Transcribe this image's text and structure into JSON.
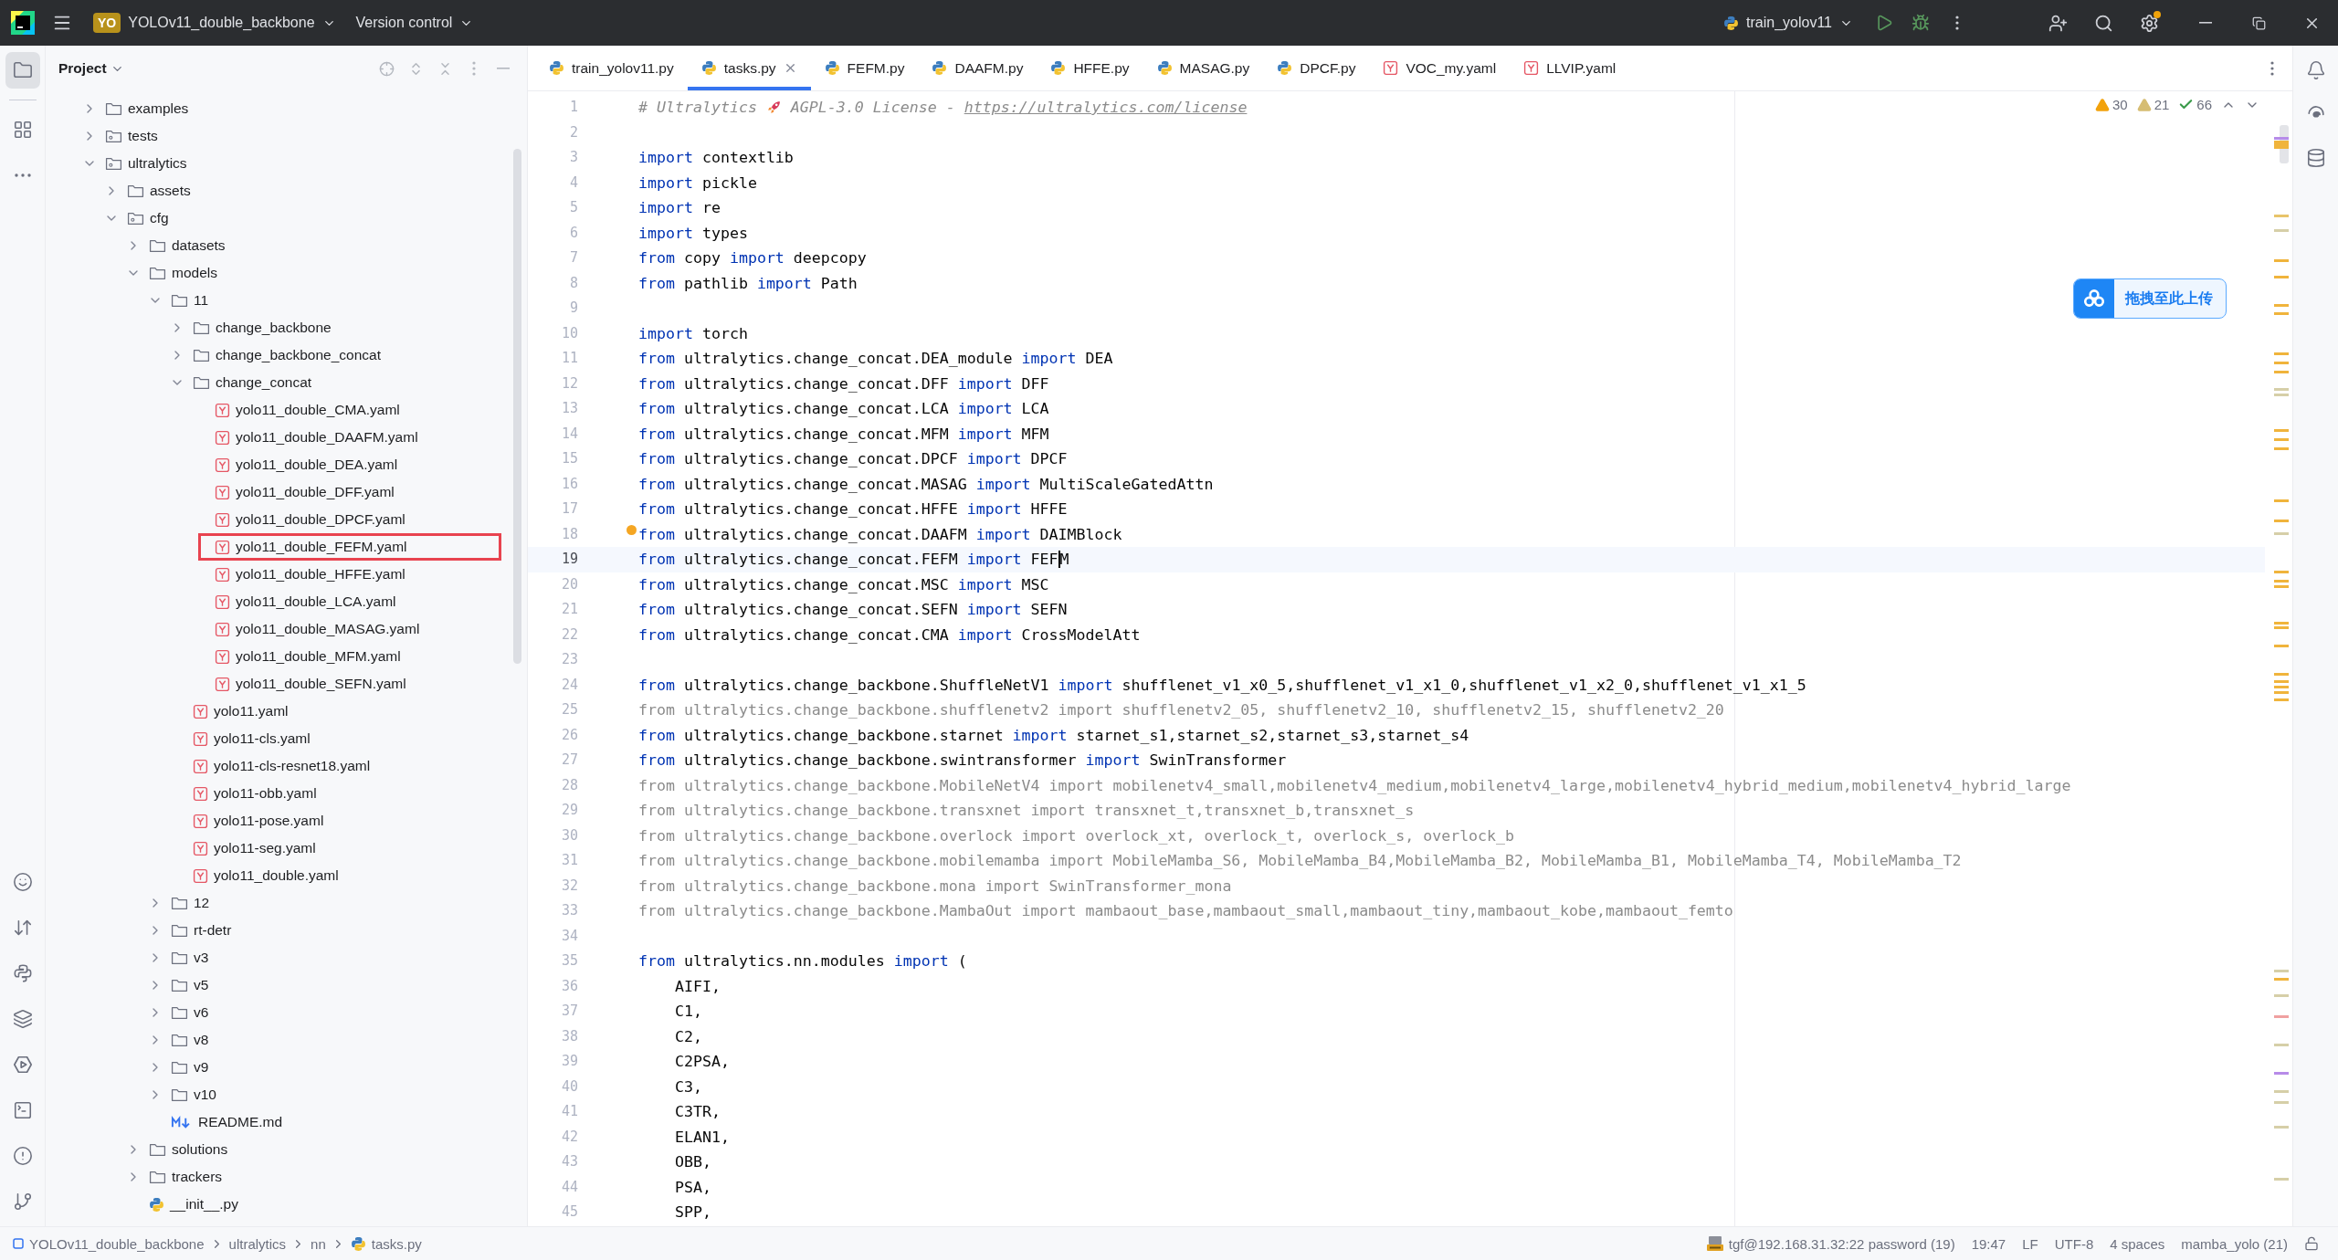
{
  "title_bar": {
    "project_badge": "YO",
    "project_name": "YOLOv11_double_backbone",
    "vcs_menu": "Version control",
    "run_config": "train_yolov11",
    "settings_update": true
  },
  "tool_strip": {
    "top": [
      {
        "kind": "project",
        "selected": true
      },
      {
        "kind": "structure",
        "selected": false
      },
      {
        "kind": "more",
        "selected": false
      }
    ],
    "bottom": [
      {
        "kind": "face",
        "selected": false
      },
      {
        "kind": "transfer",
        "selected": false
      },
      {
        "kind": "python",
        "selected": false
      },
      {
        "kind": "layers",
        "selected": false
      },
      {
        "kind": "services",
        "selected": false
      },
      {
        "kind": "terminal",
        "selected": false
      },
      {
        "kind": "problems",
        "selected": false
      },
      {
        "kind": "git",
        "selected": false
      }
    ]
  },
  "project": {
    "title": "Project",
    "tree": [
      {
        "label": "examples",
        "kind": "folder",
        "expanded": false
      },
      {
        "label": "tests",
        "kind": "package",
        "expanded": false
      },
      {
        "label": "ultralytics",
        "kind": "package",
        "expanded": true,
        "children": [
          {
            "label": "assets",
            "kind": "folder",
            "expanded": false
          },
          {
            "label": "cfg",
            "kind": "package",
            "expanded": true,
            "children": [
              {
                "label": "datasets",
                "kind": "folder",
                "expanded": false
              },
              {
                "label": "models",
                "kind": "folder",
                "expanded": true,
                "children": [
                  {
                    "label": "11",
                    "kind": "folder",
                    "expanded": true,
                    "children": [
                      {
                        "label": "change_backbone",
                        "kind": "folder",
                        "expanded": false
                      },
                      {
                        "label": "change_backbone_concat",
                        "kind": "folder",
                        "expanded": false
                      },
                      {
                        "label": "change_concat",
                        "kind": "folder",
                        "expanded": true,
                        "children": [
                          {
                            "label": "yolo11_double_CMA.yaml",
                            "kind": "yaml"
                          },
                          {
                            "label": "yolo11_double_DAAFM.yaml",
                            "kind": "yaml"
                          },
                          {
                            "label": "yolo11_double_DEA.yaml",
                            "kind": "yaml"
                          },
                          {
                            "label": "yolo11_double_DFF.yaml",
                            "kind": "yaml"
                          },
                          {
                            "label": "yolo11_double_DPCF.yaml",
                            "kind": "yaml"
                          },
                          {
                            "label": "yolo11_double_FEFM.yaml",
                            "kind": "yaml",
                            "marked": true
                          },
                          {
                            "label": "yolo11_double_HFFE.yaml",
                            "kind": "yaml"
                          },
                          {
                            "label": "yolo11_double_LCA.yaml",
                            "kind": "yaml"
                          },
                          {
                            "label": "yolo11_double_MASAG.yaml",
                            "kind": "yaml"
                          },
                          {
                            "label": "yolo11_double_MFM.yaml",
                            "kind": "yaml"
                          },
                          {
                            "label": "yolo11_double_SEFN.yaml",
                            "kind": "yaml"
                          }
                        ]
                      },
                      {
                        "label": "yolo11.yaml",
                        "kind": "yaml"
                      },
                      {
                        "label": "yolo11-cls.yaml",
                        "kind": "yaml"
                      },
                      {
                        "label": "yolo11-cls-resnet18.yaml",
                        "kind": "yaml"
                      },
                      {
                        "label": "yolo11-obb.yaml",
                        "kind": "yaml"
                      },
                      {
                        "label": "yolo11-pose.yaml",
                        "kind": "yaml"
                      },
                      {
                        "label": "yolo11-seg.yaml",
                        "kind": "yaml"
                      },
                      {
                        "label": "yolo11_double.yaml",
                        "kind": "yaml"
                      }
                    ]
                  },
                  {
                    "label": "12",
                    "kind": "folder",
                    "expanded": false
                  },
                  {
                    "label": "rt-detr",
                    "kind": "folder",
                    "expanded": false
                  },
                  {
                    "label": "v3",
                    "kind": "folder",
                    "expanded": false
                  },
                  {
                    "label": "v5",
                    "kind": "folder",
                    "expanded": false
                  },
                  {
                    "label": "v6",
                    "kind": "folder",
                    "expanded": false
                  },
                  {
                    "label": "v8",
                    "kind": "folder",
                    "expanded": false
                  },
                  {
                    "label": "v9",
                    "kind": "folder",
                    "expanded": false
                  },
                  {
                    "label": "v10",
                    "kind": "folder",
                    "expanded": false
                  },
                  {
                    "label": "README.md",
                    "kind": "md"
                  }
                ]
              },
              {
                "label": "solutions",
                "kind": "folder",
                "expanded": false
              },
              {
                "label": "trackers",
                "kind": "folder",
                "expanded": false
              },
              {
                "label": "__init__.py",
                "kind": "py"
              }
            ]
          }
        ]
      }
    ]
  },
  "tabs": [
    {
      "label": "train_yolov11.py",
      "kind": "py",
      "selected": false
    },
    {
      "label": "tasks.py",
      "kind": "py",
      "selected": true
    },
    {
      "label": "FEFM.py",
      "kind": "py",
      "selected": false
    },
    {
      "label": "DAAFM.py",
      "kind": "py",
      "selected": false
    },
    {
      "label": "HFFE.py",
      "kind": "py",
      "selected": false
    },
    {
      "label": "MASAG.py",
      "kind": "py",
      "selected": false
    },
    {
      "label": "DPCF.py",
      "kind": "py",
      "selected": false
    },
    {
      "label": "VOC_my.yaml",
      "kind": "yaml",
      "selected": false
    },
    {
      "label": "LLVIP.yaml",
      "kind": "yaml",
      "selected": false
    }
  ],
  "inspections": [
    {
      "kind": "warning",
      "count": "30"
    },
    {
      "kind": "weak_warning",
      "count": "21"
    },
    {
      "kind": "typo",
      "count": "66"
    }
  ],
  "upload_button": {
    "label": "拖拽至此上传"
  },
  "code": {
    "lines": [
      {
        "number": "1",
        "parts": [
          {
            "kind": "comment",
            "text": "# Ultralytics "
          },
          {
            "kind": "emoji"
          },
          {
            "kind": "comment",
            "text": " AGPL-3.0 License - "
          },
          {
            "kind": "link",
            "text": "https://ultralytics.com/license"
          }
        ]
      },
      {
        "number": "2"
      },
      {
        "number": "3",
        "parts": [
          {
            "kind": "keyword",
            "text": "import"
          },
          {
            "kind": "plain",
            "text": " contextlib"
          }
        ]
      },
      {
        "number": "4",
        "parts": [
          {
            "kind": "keyword",
            "text": "import"
          },
          {
            "kind": "plain",
            "text": " pickle"
          }
        ]
      },
      {
        "number": "5",
        "parts": [
          {
            "kind": "keyword",
            "text": "import"
          },
          {
            "kind": "plain",
            "text": " re"
          }
        ]
      },
      {
        "number": "6",
        "parts": [
          {
            "kind": "keyword",
            "text": "import"
          },
          {
            "kind": "plain",
            "text": " types"
          }
        ]
      },
      {
        "number": "7",
        "parts": [
          {
            "kind": "keyword",
            "text": "from"
          },
          {
            "kind": "plain",
            "text": " copy "
          },
          {
            "kind": "keyword",
            "text": "import"
          },
          {
            "kind": "plain",
            "text": " deepcopy"
          }
        ]
      },
      {
        "number": "8",
        "parts": [
          {
            "kind": "keyword",
            "text": "from"
          },
          {
            "kind": "plain",
            "text": " pathlib "
          },
          {
            "kind": "keyword",
            "text": "import"
          },
          {
            "kind": "plain",
            "text": " Path"
          }
        ]
      },
      {
        "number": "9"
      },
      {
        "number": "10",
        "parts": [
          {
            "kind": "keyword",
            "text": "import"
          },
          {
            "kind": "plain",
            "text": " torch"
          }
        ]
      },
      {
        "number": "11",
        "parts": [
          {
            "kind": "keyword",
            "text": "from"
          },
          {
            "kind": "plain",
            "text": " ultralytics.change_concat.DEA_module "
          },
          {
            "kind": "keyword",
            "text": "import"
          },
          {
            "kind": "plain",
            "text": " DEA"
          }
        ]
      },
      {
        "number": "12",
        "parts": [
          {
            "kind": "keyword",
            "text": "from"
          },
          {
            "kind": "plain",
            "text": " ultralytics.change_concat.DFF "
          },
          {
            "kind": "keyword",
            "text": "import"
          },
          {
            "kind": "plain",
            "text": " DFF"
          }
        ]
      },
      {
        "number": "13",
        "parts": [
          {
            "kind": "keyword",
            "text": "from"
          },
          {
            "kind": "plain",
            "text": " ultralytics.change_concat.LCA "
          },
          {
            "kind": "keyword",
            "text": "import"
          },
          {
            "kind": "plain",
            "text": " LCA"
          }
        ]
      },
      {
        "number": "14",
        "parts": [
          {
            "kind": "keyword",
            "text": "from"
          },
          {
            "kind": "plain",
            "text": " ultralytics.change_concat.MFM "
          },
          {
            "kind": "keyword",
            "text": "import"
          },
          {
            "kind": "plain",
            "text": " MFM"
          }
        ]
      },
      {
        "number": "15",
        "parts": [
          {
            "kind": "keyword",
            "text": "from"
          },
          {
            "kind": "plain",
            "text": " ultralytics.change_concat.DPCF "
          },
          {
            "kind": "keyword",
            "text": "import"
          },
          {
            "kind": "plain",
            "text": " DPCF"
          }
        ]
      },
      {
        "number": "16",
        "parts": [
          {
            "kind": "keyword",
            "text": "from"
          },
          {
            "kind": "plain",
            "text": " ultralytics.change_concat.MASAG "
          },
          {
            "kind": "keyword",
            "text": "import"
          },
          {
            "kind": "plain",
            "text": " MultiScaleGatedAttn"
          }
        ]
      },
      {
        "number": "17",
        "parts": [
          {
            "kind": "keyword",
            "text": "from"
          },
          {
            "kind": "plain",
            "text": " ultralytics.change_concat.HFFE "
          },
          {
            "kind": "keyword",
            "text": "import"
          },
          {
            "kind": "plain",
            "text": " HFFE"
          }
        ]
      },
      {
        "number": "18",
        "hint": true,
        "parts": [
          {
            "kind": "keyword",
            "text": "from"
          },
          {
            "kind": "plain",
            "text": " ultralytics.change_concat.DAAFM "
          },
          {
            "kind": "keyword",
            "text": "import"
          },
          {
            "kind": "plain",
            "text": " DAIMBlock"
          }
        ]
      },
      {
        "number": "19",
        "current": true,
        "parts": [
          {
            "kind": "keyword",
            "text": "from"
          },
          {
            "kind": "plain",
            "text": " ultralytics.change_concat.FEFM "
          },
          {
            "kind": "keyword",
            "text": "import"
          },
          {
            "kind": "plain",
            "text": " FEF"
          },
          {
            "kind": "plain",
            "text": "M",
            "caret": true
          }
        ]
      },
      {
        "number": "20",
        "parts": [
          {
            "kind": "keyword",
            "text": "from"
          },
          {
            "kind": "plain",
            "text": " ultralytics.change_concat.MSC "
          },
          {
            "kind": "keyword",
            "text": "import"
          },
          {
            "kind": "plain",
            "text": " MSC"
          }
        ]
      },
      {
        "number": "21",
        "parts": [
          {
            "kind": "keyword",
            "text": "from"
          },
          {
            "kind": "plain",
            "text": " ultralytics.change_concat.SEFN "
          },
          {
            "kind": "keyword",
            "text": "import"
          },
          {
            "kind": "plain",
            "text": " SEFN"
          }
        ]
      },
      {
        "number": "22",
        "parts": [
          {
            "kind": "keyword",
            "text": "from"
          },
          {
            "kind": "plain",
            "text": " ultralytics.change_concat.CMA "
          },
          {
            "kind": "keyword",
            "text": "import"
          },
          {
            "kind": "plain",
            "text": " CrossModelAtt"
          }
        ]
      },
      {
        "number": "23"
      },
      {
        "number": "24",
        "parts": [
          {
            "kind": "keyword",
            "text": "from"
          },
          {
            "kind": "plain",
            "text": " ultralytics.change_backbone.ShuffleNetV1 "
          },
          {
            "kind": "keyword",
            "text": "import"
          },
          {
            "kind": "plain",
            "text": " shufflenet_v1_x0_5,shufflenet_v1_x1_0,shufflenet_v1_x2_0,shufflenet_v1_x1_5"
          }
        ]
      },
      {
        "number": "25",
        "parts": [
          {
            "kind": "unused",
            "text": "from ultralytics.change_backbone.shufflenetv2 import shufflenetv2_05, shufflenetv2_10, shufflenetv2_15, shufflenetv2_20"
          }
        ]
      },
      {
        "number": "26",
        "parts": [
          {
            "kind": "keyword",
            "text": "from"
          },
          {
            "kind": "plain",
            "text": " ultralytics.change_backbone.starnet "
          },
          {
            "kind": "keyword",
            "text": "import"
          },
          {
            "kind": "plain",
            "text": " starnet_s1,starnet_s2,starnet_s3,starnet_s4"
          }
        ]
      },
      {
        "number": "27",
        "parts": [
          {
            "kind": "keyword",
            "text": "from"
          },
          {
            "kind": "plain",
            "text": " ultralytics.change_backbone.swintransformer "
          },
          {
            "kind": "keyword",
            "text": "import"
          },
          {
            "kind": "plain",
            "text": " SwinTransformer"
          }
        ]
      },
      {
        "number": "28",
        "parts": [
          {
            "kind": "unused",
            "text": "from ultralytics.change_backbone.MobileNetV4 import mobilenetv4_small,mobilenetv4_medium,mobilenetv4_large,mobilenetv4_hybrid_medium,mobilenetv4_hybrid_large"
          }
        ]
      },
      {
        "number": "29",
        "parts": [
          {
            "kind": "unused",
            "text": "from ultralytics.change_backbone.transxnet import transxnet_t,transxnet_b,transxnet_s"
          }
        ]
      },
      {
        "number": "30",
        "parts": [
          {
            "kind": "unused",
            "text": "from ultralytics.change_backbone.overlock import overlock_xt, overlock_t, overlock_s, overlock_b"
          }
        ]
      },
      {
        "number": "31",
        "parts": [
          {
            "kind": "unused",
            "text": "from ultralytics.change_backbone.mobilemamba import MobileMamba_S6, MobileMamba_B4,MobileMamba_B2, MobileMamba_B1, MobileMamba_T4, MobileMamba_T2"
          }
        ]
      },
      {
        "number": "32",
        "parts": [
          {
            "kind": "unused",
            "text": "from ultralytics.change_backbone.mona import SwinTransformer_mona"
          }
        ]
      },
      {
        "number": "33",
        "parts": [
          {
            "kind": "unused",
            "text": "from ultralytics.change_backbone.MambaOut import mambaout_base,mambaout_small,mambaout_tiny,mambaout_kobe,mambaout_femto"
          }
        ]
      },
      {
        "number": "34"
      },
      {
        "number": "35",
        "parts": [
          {
            "kind": "keyword",
            "text": "from"
          },
          {
            "kind": "plain",
            "text": " ultralytics.nn.modules "
          },
          {
            "kind": "keyword",
            "text": "import"
          },
          {
            "kind": "plain",
            "text": " ("
          }
        ]
      },
      {
        "number": "36",
        "parts": [
          {
            "kind": "plain",
            "text": "    AIFI,"
          }
        ]
      },
      {
        "number": "37",
        "parts": [
          {
            "kind": "plain",
            "text": "    C1,"
          }
        ]
      },
      {
        "number": "38",
        "parts": [
          {
            "kind": "plain",
            "text": "    C2,"
          }
        ]
      },
      {
        "number": "39",
        "parts": [
          {
            "kind": "plain",
            "text": "    C2PSA,"
          }
        ]
      },
      {
        "number": "40",
        "parts": [
          {
            "kind": "plain",
            "text": "    C3,"
          }
        ]
      },
      {
        "number": "41",
        "parts": [
          {
            "kind": "plain",
            "text": "    C3TR,"
          }
        ]
      },
      {
        "number": "42",
        "parts": [
          {
            "kind": "plain",
            "text": "    ELAN1,"
          }
        ]
      },
      {
        "number": "43",
        "parts": [
          {
            "kind": "plain",
            "text": "    OBB,"
          }
        ]
      },
      {
        "number": "44",
        "parts": [
          {
            "kind": "plain",
            "text": "    PSA,"
          }
        ]
      },
      {
        "number": "45",
        "parts": [
          {
            "kind": "plain",
            "text": "    SPP,"
          }
        ]
      }
    ]
  },
  "status_bar": {
    "breadcrumbs": [
      {
        "label": "YOLOv11_double_backbone",
        "kind": "project"
      },
      {
        "label": "ultralytics",
        "kind": "folder"
      },
      {
        "label": "nn",
        "kind": "folder"
      },
      {
        "label": "tasks.py",
        "kind": "py"
      }
    ],
    "widgets": [
      {
        "kind": "sftp",
        "label": "tgf@192.168.31.32:22 password (19)"
      },
      {
        "kind": "text",
        "label": "19:47"
      },
      {
        "kind": "text",
        "label": "LF"
      },
      {
        "kind": "text",
        "label": "UTF-8"
      },
      {
        "kind": "text",
        "label": "4 spaces"
      },
      {
        "kind": "text",
        "label": "mamba_yolo (21)"
      }
    ],
    "read_only": false
  }
}
